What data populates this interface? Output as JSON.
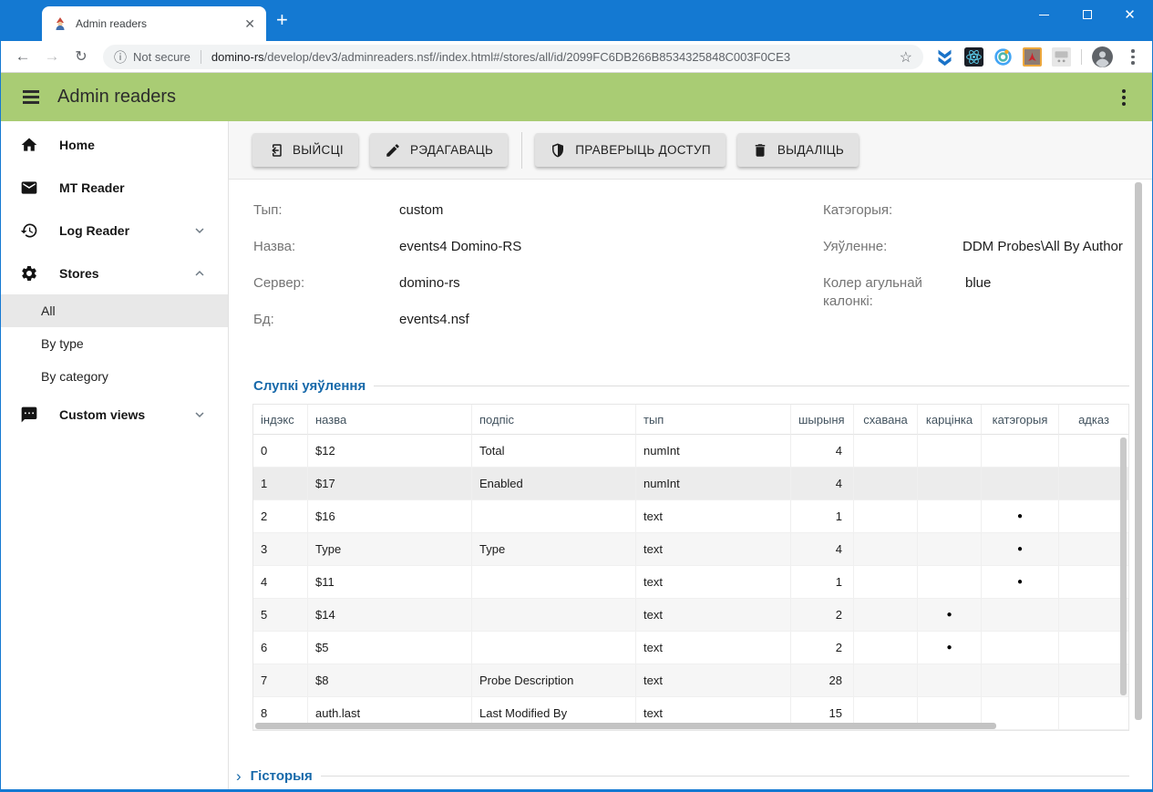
{
  "browser": {
    "tab": {
      "title": "Admin readers"
    },
    "nav": {
      "security_label": "Not secure",
      "url_domain": "domino-rs",
      "url_path": "/develop/dev3/adminreaders.nsf//index.html#/stores/all/id/2099FC6DB266B8534325848C003F0CE3"
    }
  },
  "app_header": {
    "title": "Admin readers"
  },
  "sidebar": {
    "items": [
      {
        "label": "Home"
      },
      {
        "label": "MT Reader"
      },
      {
        "label": "Log Reader"
      },
      {
        "label": "Stores"
      },
      {
        "label": "Custom views"
      }
    ],
    "stores_children": [
      {
        "label": "All",
        "active": true
      },
      {
        "label": "By type"
      },
      {
        "label": "By category"
      }
    ]
  },
  "toolbar": {
    "buttons": [
      {
        "label": "ВЫЙСЦІ"
      },
      {
        "label": "РЭДАГАВАЦЬ"
      },
      {
        "label": "ПРАВЕРЫЦЬ ДОСТУП"
      },
      {
        "label": "ВЫДАЛІЦЬ"
      }
    ]
  },
  "details": {
    "left": [
      {
        "label": "Тып:",
        "value": "custom"
      },
      {
        "label": "Назва:",
        "value": "events4 Domino-RS"
      },
      {
        "label": "Сервер:",
        "value": "domino-rs"
      },
      {
        "label": "Бд:",
        "value": "events4.nsf"
      }
    ],
    "right": [
      {
        "label": "Катэгорыя:",
        "value": ""
      },
      {
        "label": "Уяўленне:",
        "value": "DDM Probes\\All By Author"
      },
      {
        "label": "Колер агульнай калонкі:",
        "value": "blue"
      }
    ]
  },
  "columns_section": {
    "title": "Слупкі уяўлення",
    "table": {
      "headers": [
        "індэкс",
        "назва",
        "подпіс",
        "тып",
        "шырыня",
        "схавана",
        "карцінка",
        "катэгорыя",
        "адказ"
      ],
      "rows": [
        [
          "0",
          "$12",
          "Total",
          "numInt",
          "4",
          "",
          "",
          "",
          ""
        ],
        [
          "1",
          "$17",
          "Enabled",
          "numInt",
          "4",
          "",
          "",
          "",
          ""
        ],
        [
          "2",
          "$16",
          "",
          "text",
          "1",
          "",
          "",
          "●",
          ""
        ],
        [
          "3",
          "Type",
          "Type",
          "text",
          "4",
          "",
          "",
          "●",
          ""
        ],
        [
          "4",
          "$11",
          "",
          "text",
          "1",
          "",
          "",
          "●",
          ""
        ],
        [
          "5",
          "$14",
          "",
          "text",
          "2",
          "",
          "●",
          "",
          ""
        ],
        [
          "6",
          "$5",
          "",
          "text",
          "2",
          "",
          "●",
          "",
          ""
        ],
        [
          "7",
          "$8",
          "Probe Description",
          "text",
          "28",
          "",
          "",
          "",
          ""
        ],
        [
          "8",
          "auth.last",
          "Last Modified By",
          "text",
          "15",
          "",
          "",
          "",
          ""
        ]
      ]
    }
  },
  "history_section": {
    "title": "Гісторыя"
  },
  "colors": {
    "titlebar_blue": "#1479d2",
    "header_green": "#a9cc74",
    "section_title_blue": "#1769aa",
    "active_item_gray": "#e8e8e8"
  }
}
